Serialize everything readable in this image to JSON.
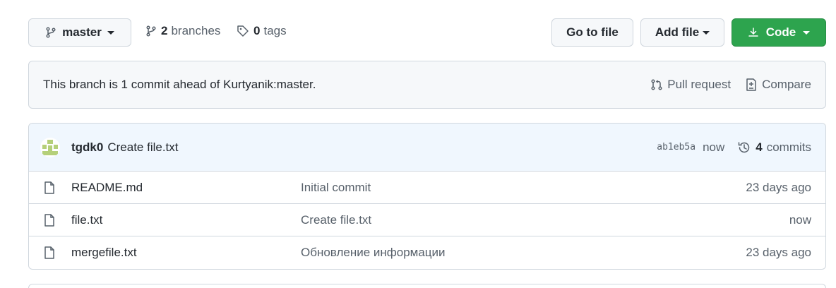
{
  "toolbar": {
    "branch_name": "master",
    "branches_count": "2",
    "branches_label": "branches",
    "tags_count": "0",
    "tags_label": "tags",
    "go_to_file_label": "Go to file",
    "add_file_label": "Add file",
    "code_label": "Code"
  },
  "ahead_banner": {
    "text": "This branch is 1 commit ahead of Kurtyanik:master.",
    "pull_request_label": "Pull request",
    "compare_label": "Compare"
  },
  "latest_commit": {
    "author": "tgdk0",
    "message": "Create file.txt",
    "sha": "ab1eb5a",
    "time": "now",
    "commits_count": "4",
    "commits_label": "commits"
  },
  "files": [
    {
      "name": "README.md",
      "commit_message": "Initial commit",
      "age": "23 days ago"
    },
    {
      "name": "file.txt",
      "commit_message": "Create file.txt",
      "age": "now"
    },
    {
      "name": "mergefile.txt",
      "commit_message": "Обновление информации",
      "age": "23 days ago"
    }
  ],
  "colors": {
    "primary_button": "#2da44e",
    "commit_header_bg": "#f0f7fe",
    "border": "#d0d7de"
  },
  "icons": [
    "branch-icon",
    "tag-icon",
    "download-icon",
    "pull-request-icon",
    "compare-icon",
    "history-icon",
    "file-icon"
  ]
}
